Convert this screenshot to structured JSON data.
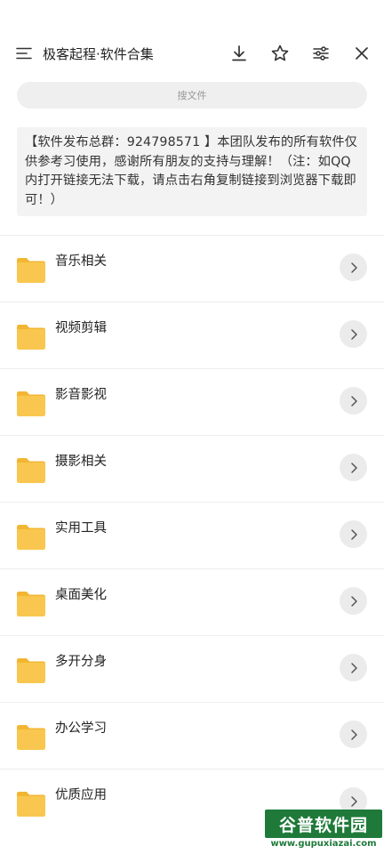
{
  "header": {
    "title": "极客起程·软件合集",
    "icons": [
      "menu-icon",
      "download-icon",
      "star-icon",
      "settings-sliders-icon",
      "close-icon"
    ]
  },
  "search": {
    "placeholder": "搜文件"
  },
  "notice": {
    "text": "【软件发布总群：924798571 】本团队发布的所有软件仅供参考习使用，感谢所有朋友的支持与理解！（注：如QQ内打开链接无法下载，请点击右角复制链接到浏览器下载即可！）"
  },
  "folders": [
    {
      "label": "音乐相关"
    },
    {
      "label": "视频剪辑"
    },
    {
      "label": "影音影视"
    },
    {
      "label": "摄影相关"
    },
    {
      "label": "实用工具"
    },
    {
      "label": "桌面美化"
    },
    {
      "label": "多开分身"
    },
    {
      "label": "办公学习"
    },
    {
      "label": "优质应用"
    }
  ],
  "watermark": {
    "name": "谷普软件园",
    "url": "www.gupuxiazai.com"
  },
  "colors": {
    "folder": "#F9C74F",
    "folder_tab": "#F2B632",
    "watermark": "#1F7A3A"
  }
}
